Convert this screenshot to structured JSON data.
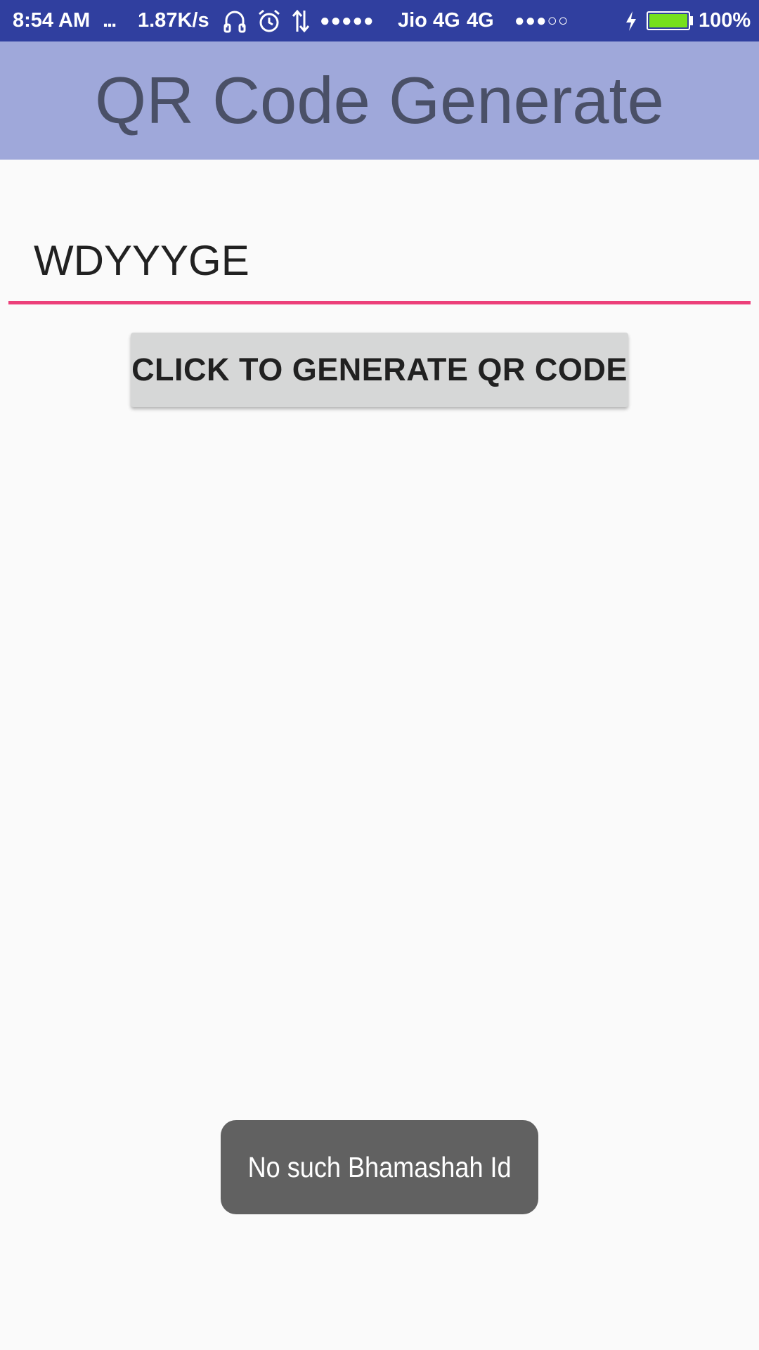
{
  "status_bar": {
    "time": "8:54 AM",
    "more_indicator": "...",
    "network_speed": "1.87K/s",
    "headphones_icon": "headphones-icon",
    "alarm_icon": "alarm-icon",
    "data_arrows_icon": "data-transfer-icon",
    "signal_dots_1": "●●●●●",
    "carrier": "Jio 4G",
    "network_type": "4G",
    "signal_dots_2": "●●●○○",
    "charging_icon": "charging-bolt-icon",
    "battery_level": 1.0,
    "battery_percent": "100%"
  },
  "app_bar": {
    "title": "QR Code Generate"
  },
  "form": {
    "input_value": "WDYYYGE",
    "button_label": "CLICK TO GENERATE QR CODE"
  },
  "toast": {
    "message": "No such Bhamashah Id"
  },
  "colors": {
    "status_bar": "#303f9f",
    "app_bar": "#9fa8da",
    "title_text": "#4a5067",
    "input_underline": "#ec407a",
    "button_bg": "#d6d7d7",
    "toast_bg": "#616161",
    "battery_fill": "#76e01d"
  }
}
